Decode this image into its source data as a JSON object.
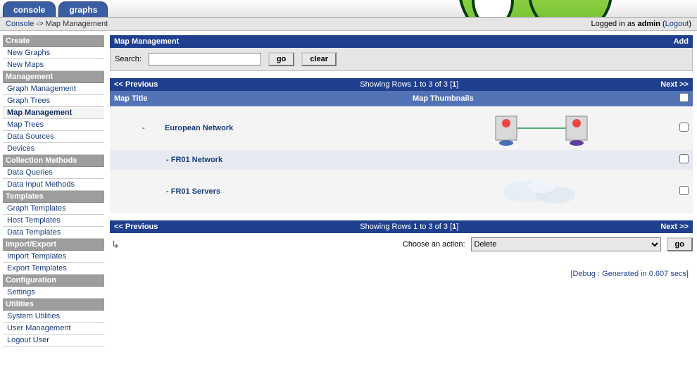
{
  "tabs": {
    "console": "console",
    "graphs": "graphs"
  },
  "breadcrumb": {
    "console": "Console",
    "sep": "->",
    "current": "Map Management"
  },
  "login": {
    "prefix": "Logged in as ",
    "user": "admin",
    "open": " (",
    "logout": "Logout",
    "close": ")"
  },
  "sidebar": {
    "sections": [
      {
        "header": "Create",
        "items": [
          "New Graphs",
          "New Maps"
        ]
      },
      {
        "header": "Management",
        "items": [
          "Graph Management",
          "Graph Trees",
          "Map Management",
          "Map Trees",
          "Data Sources",
          "Devices"
        ],
        "active": "Map Management"
      },
      {
        "header": "Collection Methods",
        "items": [
          "Data Queries",
          "Data Input Methods"
        ]
      },
      {
        "header": "Templates",
        "items": [
          "Graph Templates",
          "Host Templates",
          "Data Templates"
        ]
      },
      {
        "header": "Import/Export",
        "items": [
          "Import Templates",
          "Export Templates"
        ]
      },
      {
        "header": "Configuration",
        "items": [
          "Settings"
        ]
      },
      {
        "header": "Utilities",
        "items": [
          "System Utilities",
          "User Management",
          "Logout User"
        ]
      }
    ]
  },
  "panel": {
    "title": "Map Management",
    "add": "Add",
    "search_label": "Search:",
    "search_value": "",
    "go": "go",
    "clear": "clear"
  },
  "pager": {
    "prev": "<< Previous",
    "showing_prefix": "Showing Rows 1 to 3 of 3 [",
    "page": "1",
    "showing_suffix": "]",
    "next": "Next >>"
  },
  "table": {
    "col_title": "Map Title",
    "col_thumb": "Map Thumbnails",
    "rows": [
      {
        "indent": 1,
        "title": "European Network",
        "thumb": "network"
      },
      {
        "indent": 2,
        "title": "- FR01 Network",
        "thumb": "none"
      },
      {
        "indent": 2,
        "title": "- FR01 Servers",
        "thumb": "ghost"
      }
    ]
  },
  "action": {
    "label": "Choose an action:",
    "selected": "Delete",
    "go": "go"
  },
  "debug": "[Debug : Generated in 0.607 secs]"
}
